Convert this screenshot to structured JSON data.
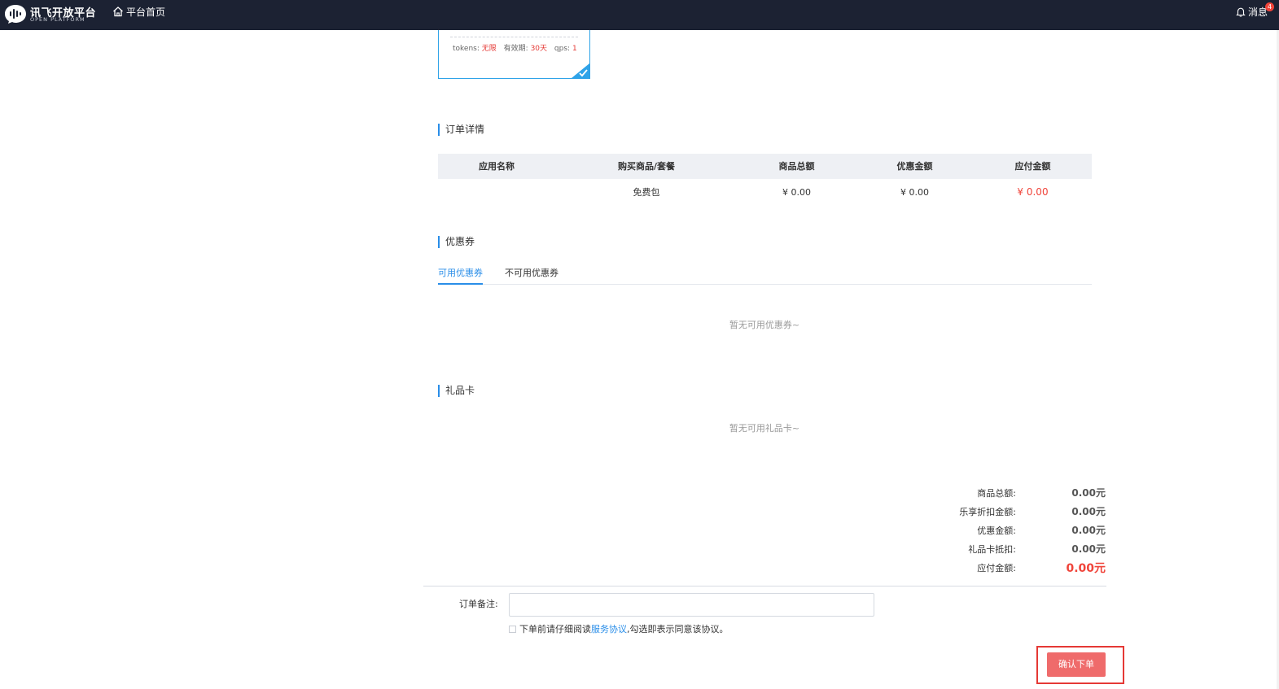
{
  "header": {
    "logo_main": "讯飞开放平台",
    "logo_sub": "OPEN PLATFORM",
    "home_link": "平台首页",
    "messages_label": "消息",
    "messages_count": "4",
    "icons": [
      "logo-icon",
      "home-icon",
      "bell-icon"
    ],
    "background_color": "#1c2233"
  },
  "package_card": {
    "tokens_label": "tokens:",
    "tokens_value": "无限",
    "validity_label": "有效期:",
    "validity_value": "30天",
    "qps_label": "qps:",
    "qps_value": "1",
    "selected": true
  },
  "order_details": {
    "title": "订单详情",
    "columns": [
      "应用名称",
      "购买商品/套餐",
      "商品总额",
      "优惠金额",
      "应付金额"
    ],
    "rows": [
      {
        "app_name": "",
        "product": "免费包",
        "total": "¥ 0.00",
        "discount": "¥ 0.00",
        "payable": "¥ 0.00"
      }
    ]
  },
  "coupons": {
    "title": "优惠券",
    "tabs": [
      {
        "label": "可用优惠券",
        "active": true
      },
      {
        "label": "不可用优惠券",
        "active": false
      }
    ],
    "empty_text": "暂无可用优惠券~"
  },
  "gift_cards": {
    "title": "礼品卡",
    "empty_text": "暂无可用礼品卡~"
  },
  "summary": {
    "rows": [
      {
        "label": "商品总额:",
        "value": "0.00元"
      },
      {
        "label": "乐享折扣金额:",
        "value": "0.00元"
      },
      {
        "label": "优惠金额:",
        "value": "0.00元"
      },
      {
        "label": "礼品卡抵扣:",
        "value": "0.00元"
      },
      {
        "label": "应付金额:",
        "value": "0.00元"
      }
    ]
  },
  "remark": {
    "label": "订单备注:",
    "value": "",
    "placeholder": ""
  },
  "agreement": {
    "checked": false,
    "text_before": "下单前请仔细阅读",
    "link_text": "服务协议",
    "text_after": ",勾选即表示同意该协议。"
  },
  "confirm_button": {
    "label": "确认下单",
    "color": "#ef6b6b"
  },
  "colors": {
    "accent": "#2a8ee8",
    "price_red": "#f0443a"
  }
}
